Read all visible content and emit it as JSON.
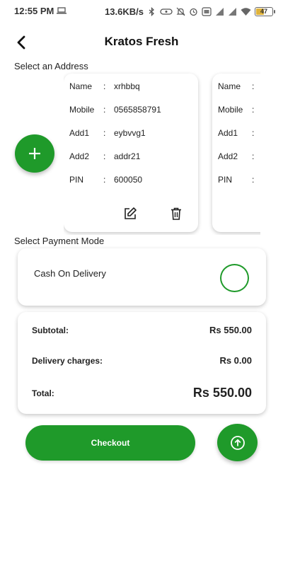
{
  "status_bar": {
    "time": "12:55 PM",
    "net_speed": "13.6KB/s",
    "battery": "47",
    "battery_level": 0.47,
    "icons": [
      "laptop-icon",
      "bluetooth-icon",
      "vibrate-icon",
      "mute-icon",
      "alarm-icon",
      "volte-icon",
      "signal-icon",
      "signal-icon",
      "wifi-icon",
      "battery-icon"
    ]
  },
  "header": {
    "title": "Kratos Fresh",
    "back_icon": "back-arrow-icon"
  },
  "address_section": {
    "label": "Select an Address",
    "add_icon": "plus-icon",
    "cards": [
      {
        "rows": [
          {
            "key": "Name",
            "colon": ":",
            "value": "xrhbbq"
          },
          {
            "key": "Mobile",
            "colon": ":",
            "value": "0565858791"
          },
          {
            "key": "Add1",
            "colon": ":",
            "value": "eybvvg1"
          },
          {
            "key": "Add2",
            "colon": ":",
            "value": "addr21"
          },
          {
            "key": "PIN",
            "colon": ":",
            "value": "600050"
          }
        ],
        "edit_icon": "edit-icon",
        "delete_icon": "trash-icon"
      },
      {
        "rows": [
          {
            "key": "Name",
            "colon": ":",
            "value": ""
          },
          {
            "key": "Mobile",
            "colon": ":",
            "value": ""
          },
          {
            "key": "Add1",
            "colon": ":",
            "value": ""
          },
          {
            "key": "Add2",
            "colon": ":",
            "value": ""
          },
          {
            "key": "PIN",
            "colon": ":",
            "value": ""
          }
        ]
      }
    ]
  },
  "payment_section": {
    "label": "Select Payment Mode",
    "option": "Cash On Delivery",
    "selected": false
  },
  "totals": {
    "subtotal_label": "Subtotal:",
    "subtotal_value": "Rs 550.00",
    "delivery_label": "Delivery charges:",
    "delivery_value": "Rs 0.00",
    "total_label": "Total:",
    "total_value": "Rs 550.00"
  },
  "actions": {
    "checkout_label": "Checkout",
    "scroll_up_icon": "arrow-up-circle-icon"
  },
  "colors": {
    "accent": "#1f9a2a",
    "background": "#ffffff",
    "text": "#222222"
  }
}
